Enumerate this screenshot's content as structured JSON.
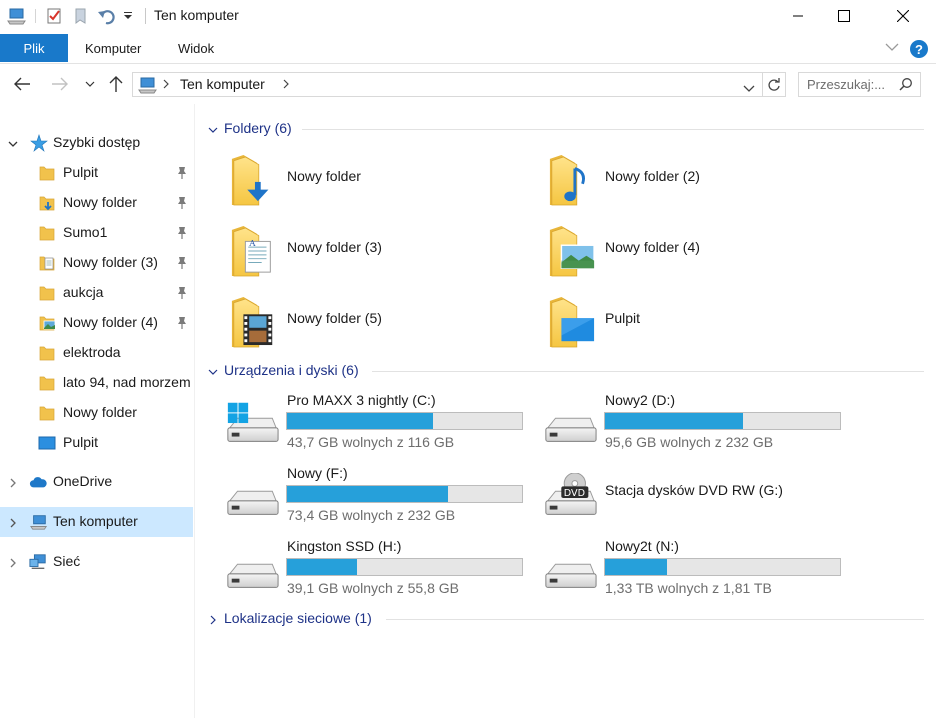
{
  "window": {
    "title": "Ten komputer"
  },
  "ribbon": {
    "tabs": [
      "Plik",
      "Komputer",
      "Widok"
    ],
    "help": "?"
  },
  "address": {
    "path": "Ten komputer",
    "search_placeholder": "Przeszukaj:..."
  },
  "sidebar": {
    "quick_access": "Szybki dostęp",
    "quick_items": [
      {
        "label": "Pulpit",
        "pinned": true,
        "icon": "folder-icon"
      },
      {
        "label": "Nowy folder",
        "pinned": true,
        "icon": "downloads-folder-icon"
      },
      {
        "label": "Sumo1",
        "pinned": true,
        "icon": "folder-icon"
      },
      {
        "label": "Nowy folder (3)",
        "pinned": true,
        "icon": "documents-folder-icon"
      },
      {
        "label": "aukcja",
        "pinned": true,
        "icon": "folder-icon"
      },
      {
        "label": "Nowy folder (4)",
        "pinned": true,
        "icon": "pictures-folder-icon"
      },
      {
        "label": "elektroda",
        "pinned": false,
        "icon": "folder-icon"
      },
      {
        "label": "lato 94, nad morzem",
        "pinned": false,
        "icon": "folder-icon"
      },
      {
        "label": "Nowy folder",
        "pinned": false,
        "icon": "folder-icon"
      },
      {
        "label": "Pulpit",
        "pinned": false,
        "icon": "desktop-icon"
      }
    ],
    "onedrive": "OneDrive",
    "this_pc": "Ten komputer",
    "network": "Sieć"
  },
  "main": {
    "folders_header": "Foldery (6)",
    "folders": [
      {
        "label": "Nowy folder",
        "icon": "downloads-folder-icon"
      },
      {
        "label": "Nowy folder (2)",
        "icon": "music-folder-icon"
      },
      {
        "label": "Nowy folder (3)",
        "icon": "documents-folder-icon"
      },
      {
        "label": "Nowy folder (4)",
        "icon": "pictures-folder-icon"
      },
      {
        "label": "Nowy folder (5)",
        "icon": "videos-folder-icon"
      },
      {
        "label": "Pulpit",
        "icon": "desktop-folder-icon"
      }
    ],
    "devices_header": "Urządzenia i dyski (6)",
    "drives": [
      {
        "name": "Pro MAXX 3 nightly (C:)",
        "free": "43,7 GB wolnych z 116 GB",
        "used_fraction": 0.623,
        "icon": "windows-drive-icon"
      },
      {
        "name": "Nowy2 (D:)",
        "free": "95,6 GB wolnych z 232 GB",
        "used_fraction": 0.588,
        "icon": "hard-drive-icon"
      },
      {
        "name": "Nowy (F:)",
        "free": "73,4 GB wolnych z 232 GB",
        "used_fraction": 0.684,
        "icon": "hard-drive-icon"
      },
      {
        "name": "Stacja dysków DVD RW (G:)",
        "free": "",
        "used_fraction": null,
        "icon": "dvd-drive-icon"
      },
      {
        "name": "Kingston SSD (H:)",
        "free": "39,1 GB wolnych z 55,8 GB",
        "used_fraction": 0.299,
        "icon": "hard-drive-icon"
      },
      {
        "name": "Nowy2t (N:)",
        "free": "1,33 TB wolnych z 1,81 TB",
        "used_fraction": 0.265,
        "icon": "hard-drive-icon"
      }
    ],
    "network_header": "Lokalizacje sieciowe (1)",
    "dvd_label": "DVD"
  },
  "colors": {
    "accent": "#1979ca",
    "bar_fill": "#26a0da",
    "header_text": "#1e3287",
    "selected_bg": "#cce8ff"
  }
}
